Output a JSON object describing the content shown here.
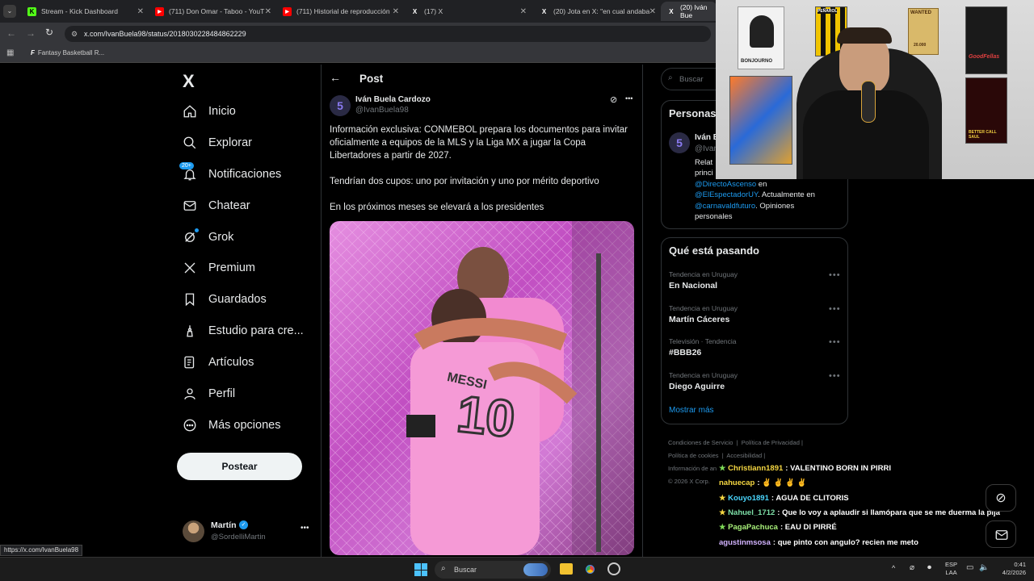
{
  "browser": {
    "tabs": [
      {
        "label": "Stream - Kick Dashboard",
        "favicon": "K",
        "color": "#53fc18"
      },
      {
        "label": "(711) Don Omar - Taboo - YouT",
        "favicon": "▶",
        "color": "#ff0000"
      },
      {
        "label": "(711) Historial de reproducción",
        "favicon": "▶",
        "color": "#ff0000"
      },
      {
        "label": "(17) X",
        "favicon": "X",
        "color": "#ffffff"
      },
      {
        "label": "(20) Jota en X: \"en cual andaba",
        "favicon": "X",
        "color": "#ffffff"
      },
      {
        "label": "(20) Iván Bue",
        "favicon": "X",
        "color": "#ffffff"
      }
    ],
    "url": "x.com/IvanBuela98/status/2018030228484862229",
    "bookmark": "Fantasy Basketball R...",
    "status_url": "https://x.com/IvanBuela98"
  },
  "nav": {
    "logo": "X",
    "items": [
      {
        "label": "Inicio",
        "icon": "home-icon"
      },
      {
        "label": "Explorar",
        "icon": "search-icon"
      },
      {
        "label": "Notificaciones",
        "icon": "bell-icon",
        "badge": "20+"
      },
      {
        "label": "Chatear",
        "icon": "mail-icon"
      },
      {
        "label": "Grok",
        "icon": "grok-icon"
      },
      {
        "label": "Premium",
        "icon": "x-icon"
      },
      {
        "label": "Guardados",
        "icon": "bookmark-icon"
      },
      {
        "label": "Estudio para cre...",
        "icon": "creator-icon"
      },
      {
        "label": "Artículos",
        "icon": "article-icon"
      },
      {
        "label": "Perfil",
        "icon": "person-icon"
      },
      {
        "label": "Más opciones",
        "icon": "more-icon"
      }
    ],
    "post_button": "Postear",
    "account": {
      "name": "Martín",
      "handle": "@SordelliMartin"
    }
  },
  "post": {
    "header": "Post",
    "author_name": "Iván Buela Cardozo",
    "author_handle": "@IvanBuela98",
    "paragraphs": [
      "Información exclusiva: CONMEBOL prepara los documentos para invitar oficialmente a equipos de la MLS y la Liga MX a jugar la Copa Libertadores a partir de 2027.",
      "Tendrían dos cupos: uno por invitación y uno por mérito deportivo",
      "En los próximos meses se elevará a los presidentes"
    ],
    "image_jersey_name": "MESSI",
    "image_jersey_number": "10"
  },
  "right": {
    "search_placeholder": "Buscar",
    "relevant_title": "Personas",
    "relevant_name": "Iván B",
    "relevant_handle": "@Ivan",
    "bio_line1": "Relat",
    "bio_line2": "princi",
    "bio_line3_link": "@DirectoAscenso",
    "bio_line3_text": " en",
    "bio_line4_link": "@ElEspectadorUY",
    "bio_line4_text": ". Actualmente en",
    "bio_line5_link": "@carnavaldfuturo",
    "bio_line5_text": ". Opiniones",
    "bio_line6": "personales",
    "trends_title": "Qué está pasando",
    "trends": [
      {
        "meta": "Tendencia en Uruguay",
        "name": "En Nacional"
      },
      {
        "meta": "Tendencia en Uruguay",
        "name": "Martín Cáceres"
      },
      {
        "meta": "Televisión · Tendencia",
        "name": "#BBB26"
      },
      {
        "meta": "Tendencia en Uruguay",
        "name": "Diego Aguirre"
      }
    ],
    "show_more": "Mostrar más",
    "footer": [
      "Condiciones de Servicio",
      "Política de Privacidad",
      "Política de cookies",
      "Accesibilidad",
      "Información de an",
      "© 2026 X Corp."
    ]
  },
  "webcam_posters": {
    "p1": "BONJOURNO",
    "p2": "PEÑAROL",
    "p3": "WANTED",
    "p3b": "20.000",
    "p4": "GoodFellas",
    "p5": "BETTER CALL SAUL"
  },
  "chat": [
    {
      "user": "Christiann1891",
      "msg": "VALENTINO BORN IN PIRRI",
      "color": "#f5d742",
      "star": true
    },
    {
      "user": "nahuecap",
      "msg": "✌ ✌ ✌ ✌",
      "color": "#f5d742",
      "star": false
    },
    {
      "user": "Kouyo1891",
      "msg": "AGUA DE CLITORIS",
      "color": "#4ad7ff",
      "star": true
    },
    {
      "user": "Nahuel_1712",
      "msg": "Que lo voy a aplaudir si llamópara que se me duerma la pija",
      "color": "#7ee0a8",
      "star": true
    },
    {
      "user": "PagaPachuca",
      "msg": "EAU DI PIRRÉ",
      "color": "#a8f07a",
      "star": true
    },
    {
      "user": "agustinmsosa",
      "msg": "que pinto con angulo? recien me meto",
      "color": "#d2b3ff",
      "star": false
    }
  ],
  "taskbar": {
    "search": "Buscar",
    "lang1": "ESP",
    "lang2": "LAA",
    "time": "0:41",
    "date": "4/2/2026"
  }
}
